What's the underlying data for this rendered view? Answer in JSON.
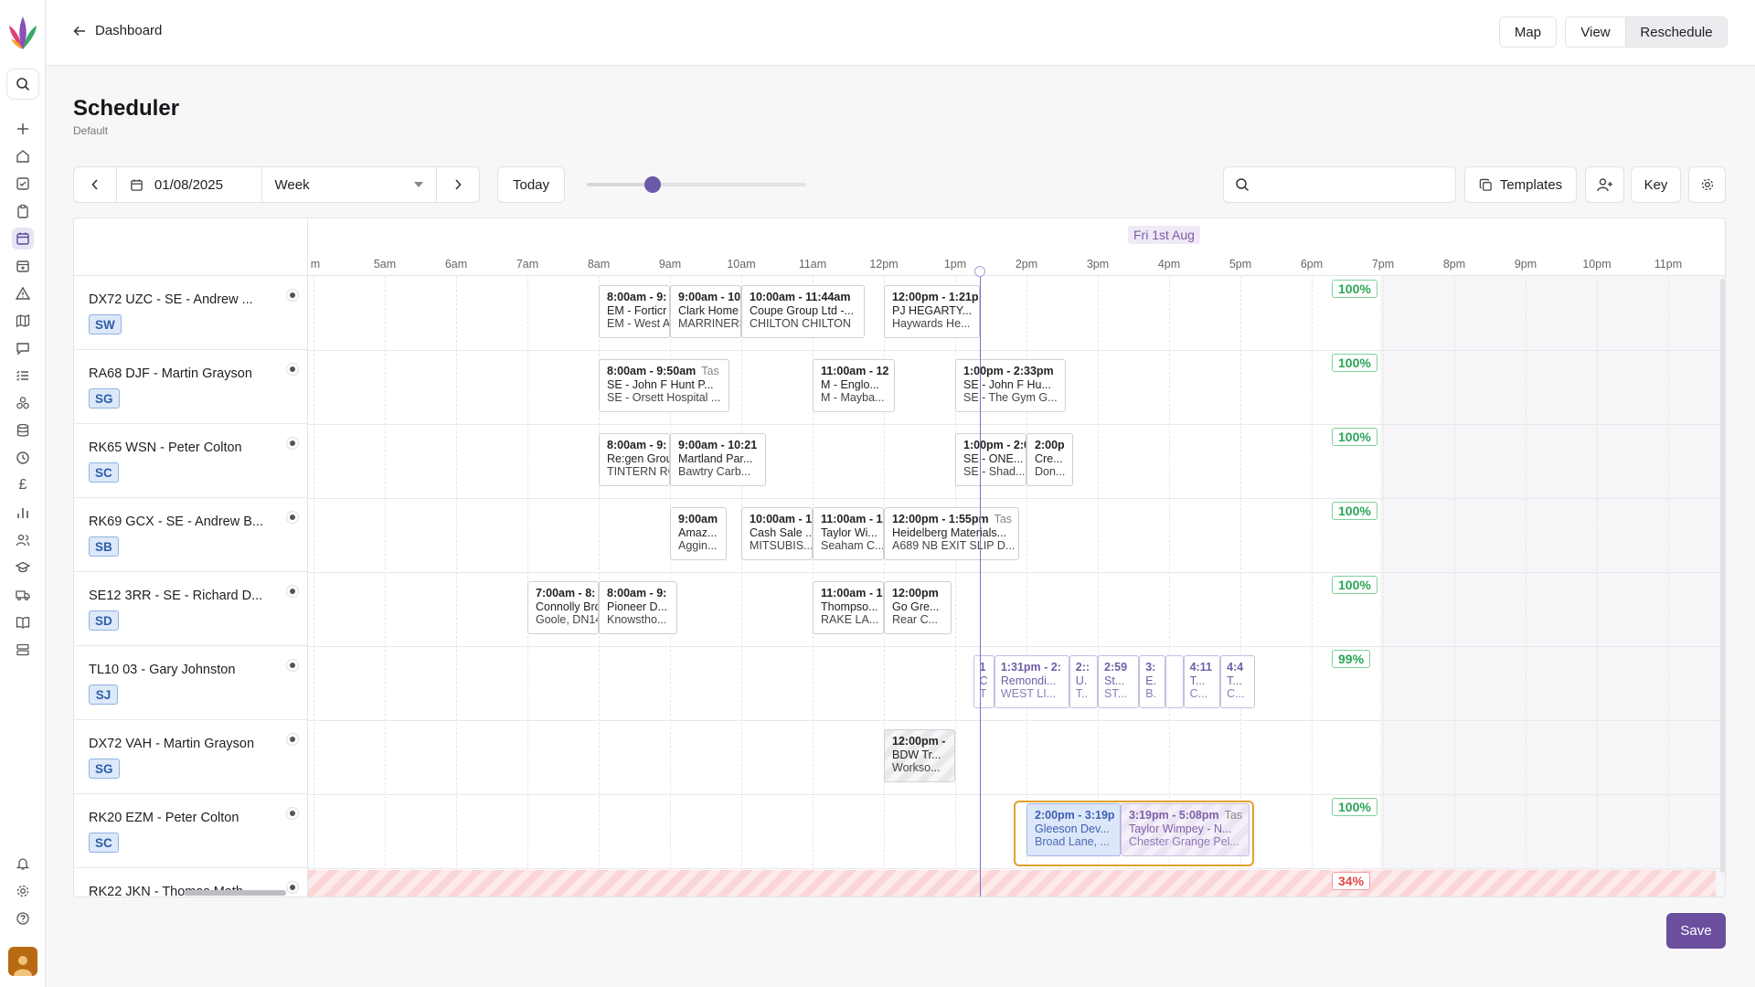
{
  "nav": {
    "back_label": "Dashboard"
  },
  "top_actions": {
    "map": "Map",
    "view": "View",
    "reschedule": "Reschedule"
  },
  "page": {
    "title": "Scheduler",
    "subtitle": "Default"
  },
  "toolbar": {
    "date": "01/08/2025",
    "range": "Week",
    "today": "Today",
    "zoom_level": 0.3,
    "search_value": "",
    "templates": "Templates",
    "key": "Key"
  },
  "timeline": {
    "day_label": "Fri 1st Aug",
    "hours": [
      "m",
      "5am",
      "6am",
      "7am",
      "8am",
      "9am",
      "10am",
      "11am",
      "12pm",
      "1pm",
      "2pm",
      "3pm",
      "4pm",
      "5pm",
      "6pm",
      "7pm",
      "8pm",
      "9pm",
      "10pm",
      "11pm"
    ]
  },
  "resources": [
    {
      "name": "DX72 UZC - SE - Andrew ...",
      "badge": "SW",
      "utilisation": "100%"
    },
    {
      "name": "RA68 DJF - Martin Grayson",
      "badge": "SG",
      "utilisation": "100%"
    },
    {
      "name": "RK65 WSN - Peter Colton",
      "badge": "SC",
      "utilisation": "100%"
    },
    {
      "name": "RK69 GCX - SE - Andrew B...",
      "badge": "SB",
      "utilisation": "100%"
    },
    {
      "name": "SE12 3RR - SE - Richard D...",
      "badge": "SD",
      "utilisation": "100%"
    },
    {
      "name": "TL10 03 - Gary Johnston",
      "badge": "SJ",
      "utilisation": "99%"
    },
    {
      "name": "DX72 VAH - Martin Grayson",
      "badge": "SG",
      "utilisation": ""
    },
    {
      "name": "RK20 EZM - Peter Colton",
      "badge": "SC",
      "utilisation": "100%"
    },
    {
      "name": "RK22 JKN - Thomas Math...",
      "badge": "",
      "utilisation": "34%"
    }
  ],
  "events": [
    {
      "row": 0,
      "start": 8.0,
      "end": 9.0,
      "lines": [
        "8:00am - 9:",
        "EM - Forticr",
        "EM - West A"
      ],
      "tag": "",
      "style": ""
    },
    {
      "row": 0,
      "start": 9.0,
      "end": 10.0,
      "lines": [
        "9:00am - 10",
        "Clark Home",
        "MARRINERS"
      ],
      "tag": "",
      "style": ""
    },
    {
      "row": 0,
      "start": 10.0,
      "end": 11.73,
      "lines": [
        "10:00am - 11:44am",
        "Coupe Group Ltd -...",
        "CHILTON CHILTON"
      ],
      "tag": "",
      "style": ""
    },
    {
      "row": 0,
      "start": 12.0,
      "end": 13.35,
      "lines": [
        "12:00pm - 1:21p",
        "PJ HEGARTY...",
        "Haywards He..."
      ],
      "tag": "",
      "style": ""
    },
    {
      "row": 1,
      "start": 8.0,
      "end": 9.83,
      "lines": [
        "8:00am - 9:50am",
        "SE - John F Hunt P...",
        "SE - Orsett Hospital ..."
      ],
      "tag": "Tas",
      "style": ""
    },
    {
      "row": 1,
      "start": 11.0,
      "end": 12.15,
      "lines": [
        "11:00am - 12",
        "M - Englo...",
        "M - Mayba..."
      ],
      "tag": "",
      "style": ""
    },
    {
      "row": 1,
      "start": 13.0,
      "end": 14.55,
      "lines": [
        "1:00pm - 2:33pm",
        "SE - John F Hu...",
        "SE - The Gym G..."
      ],
      "tag": "",
      "style": ""
    },
    {
      "row": 2,
      "start": 8.0,
      "end": 9.0,
      "lines": [
        "8:00am - 9:",
        "Re:gen Grou",
        "TINTERN RO"
      ],
      "tag": "",
      "style": ""
    },
    {
      "row": 2,
      "start": 9.0,
      "end": 10.35,
      "lines": [
        "9:00am - 10:21",
        "Martland Par...",
        "Bawtry Carb..."
      ],
      "tag": "",
      "style": ""
    },
    {
      "row": 2,
      "start": 13.0,
      "end": 14.0,
      "lines": [
        "1:00pm - 2:0",
        "SE - ONE...",
        "SE - Shad..."
      ],
      "tag": "",
      "style": ""
    },
    {
      "row": 2,
      "start": 14.0,
      "end": 14.65,
      "lines": [
        "2:00p",
        "Cre...",
        "Don..."
      ],
      "tag": "",
      "style": ""
    },
    {
      "row": 3,
      "start": 9.0,
      "end": 9.8,
      "lines": [
        "9:00am",
        "Amaz...",
        "Aggin..."
      ],
      "tag": "",
      "style": ""
    },
    {
      "row": 3,
      "start": 10.0,
      "end": 11.0,
      "lines": [
        "10:00am - 11",
        "Cash Sale ...",
        "MITSUBIS..."
      ],
      "tag": "",
      "style": ""
    },
    {
      "row": 3,
      "start": 11.0,
      "end": 12.0,
      "lines": [
        "11:00am - 12",
        "Taylor Wi...",
        "Seaham C..."
      ],
      "tag": "",
      "style": ""
    },
    {
      "row": 3,
      "start": 12.0,
      "end": 13.9,
      "lines": [
        "12:00pm - 1:55pm",
        "Heidelberg Materials...",
        "A689 NB EXIT SLIP D..."
      ],
      "tag": "Tas",
      "style": ""
    },
    {
      "row": 4,
      "start": 7.0,
      "end": 8.0,
      "lines": [
        "7:00am - 8:",
        "Connolly Bro",
        "Goole, DN14"
      ],
      "tag": "",
      "style": ""
    },
    {
      "row": 4,
      "start": 8.0,
      "end": 9.1,
      "lines": [
        "8:00am - 9:",
        "Pioneer D...",
        "Knowstho..."
      ],
      "tag": "",
      "style": ""
    },
    {
      "row": 4,
      "start": 11.0,
      "end": 12.0,
      "lines": [
        "11:00am - 1:",
        "Thompso...",
        "RAKE LA..."
      ],
      "tag": "",
      "style": ""
    },
    {
      "row": 4,
      "start": 12.0,
      "end": 12.95,
      "lines": [
        "12:00pm",
        "Go Gre...",
        "Rear C..."
      ],
      "tag": "",
      "style": ""
    },
    {
      "row": 5,
      "start": 13.25,
      "end": 13.55,
      "lines": [
        "1",
        "C",
        "T"
      ],
      "tag": "",
      "style": "purple"
    },
    {
      "row": 5,
      "start": 13.55,
      "end": 14.6,
      "lines": [
        "1:31pm - 2:",
        "Remondi...",
        "WEST LI..."
      ],
      "tag": "",
      "style": "purple"
    },
    {
      "row": 5,
      "start": 14.6,
      "end": 15.0,
      "lines": [
        "2::",
        "U.",
        "T.."
      ],
      "tag": "",
      "style": "purple"
    },
    {
      "row": 5,
      "start": 15.0,
      "end": 15.58,
      "lines": [
        "2:59",
        "St...",
        "ST..."
      ],
      "tag": "",
      "style": "purple"
    },
    {
      "row": 5,
      "start": 15.58,
      "end": 15.95,
      "lines": [
        "3:",
        "E.",
        "B."
      ],
      "tag": "",
      "style": "purple"
    },
    {
      "row": 5,
      "start": 15.95,
      "end": 16.2,
      "lines": [
        "",
        "",
        ""
      ],
      "tag": "",
      "style": "purple"
    },
    {
      "row": 5,
      "start": 16.2,
      "end": 16.72,
      "lines": [
        "4:11",
        "T...",
        "C..."
      ],
      "tag": "",
      "style": "purple"
    },
    {
      "row": 5,
      "start": 16.72,
      "end": 17.2,
      "lines": [
        "4:4",
        "T...",
        "C..."
      ],
      "tag": "",
      "style": "purple"
    },
    {
      "row": 6,
      "start": 12.0,
      "end": 13.0,
      "lines": [
        "12:00pm -",
        "BDW Tr...",
        "Workso..."
      ],
      "tag": "",
      "style": "grey"
    },
    {
      "row": 7,
      "start": 14.0,
      "end": 15.32,
      "lines": [
        "2:00pm - 3:19p",
        "Gleeson Dev...",
        "Broad Lane, ..."
      ],
      "tag": "",
      "style": "blue"
    },
    {
      "row": 7,
      "start": 15.32,
      "end": 17.13,
      "lines": [
        "3:19pm - 5:08pm",
        "Taylor Wimpey - N...",
        "Chester Grange Pel..."
      ],
      "tag": "Tas",
      "style": "lilac"
    }
  ],
  "footer": {
    "save": "Save"
  }
}
